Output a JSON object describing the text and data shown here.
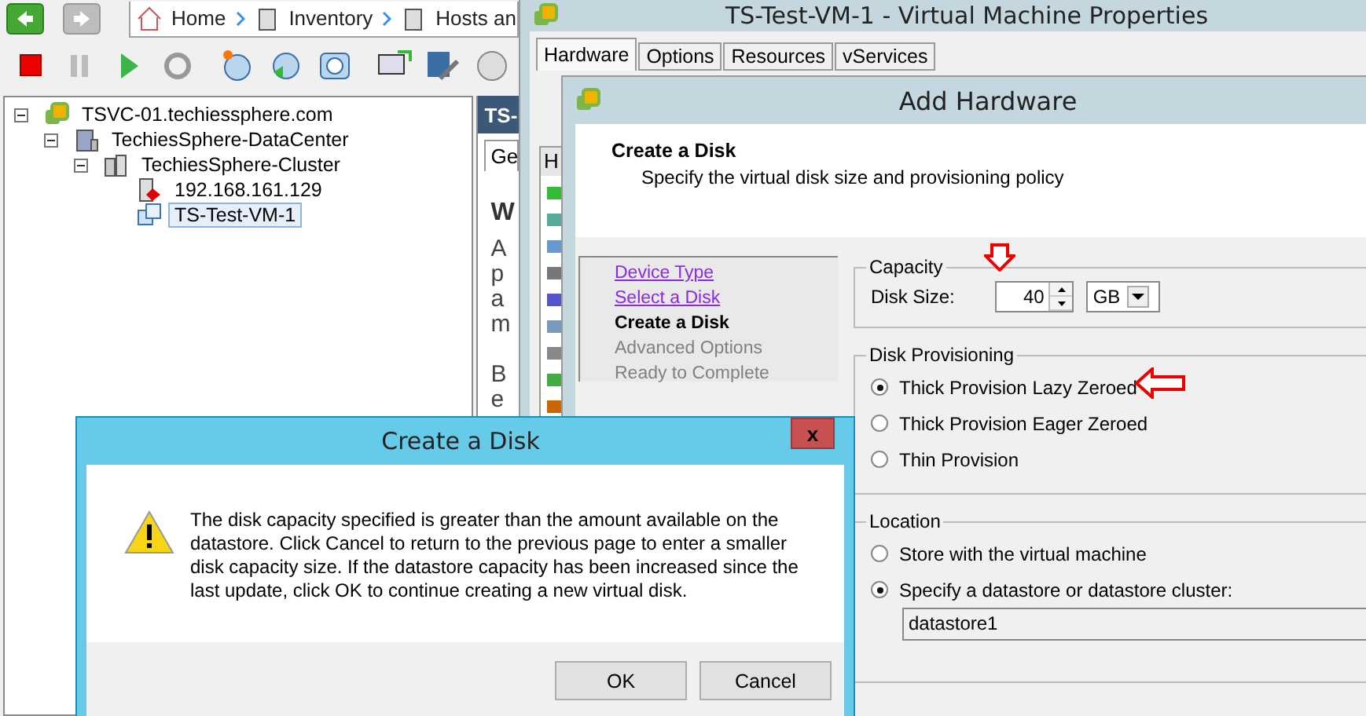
{
  "main_window": {
    "breadcrumb": [
      "Home",
      "Inventory",
      "Hosts an"
    ],
    "tree": [
      {
        "label": "TSVC-01.techiessphere.com",
        "kind": "vcenter",
        "expanded": true,
        "selected": false,
        "children": [
          {
            "label": "TechiesSphere-DataCenter",
            "kind": "datacenter",
            "expanded": true,
            "selected": false,
            "children": [
              {
                "label": "TechiesSphere-Cluster",
                "kind": "cluster",
                "expanded": true,
                "selected": false,
                "children": [
                  {
                    "label": "192.168.161.129",
                    "kind": "host",
                    "selected": false
                  },
                  {
                    "label": "TS-Test-VM-1",
                    "kind": "vm",
                    "selected": true
                  }
                ]
              }
            ]
          }
        ]
      }
    ],
    "detail_panel": {
      "title": "TS-",
      "tab": "Ge",
      "heading": "W",
      "fragments": [
        "A",
        "p",
        "a",
        "m",
        "B",
        "e"
      ]
    }
  },
  "vm_properties": {
    "title": "TS-Test-VM-1 - Virtual Machine Properties",
    "tabs": [
      {
        "label": "Hardware",
        "selected": true
      },
      {
        "label": "Options",
        "selected": false
      },
      {
        "label": "Resources",
        "selected": false
      },
      {
        "label": "vServices",
        "selected": false
      }
    ],
    "list_header": "H"
  },
  "add_hardware": {
    "title": "Add Hardware",
    "step_title": "Create a Disk",
    "step_subtitle": "Specify the virtual disk size and provisioning policy",
    "steps": [
      {
        "label": "Device Type",
        "kind": "link"
      },
      {
        "label": "Select a Disk",
        "kind": "link"
      },
      {
        "label": "Create a Disk",
        "kind": "current"
      },
      {
        "label": "Advanced Options",
        "kind": "pending"
      },
      {
        "label": "Ready to Complete",
        "kind": "pending"
      }
    ],
    "capacity": {
      "legend": "Capacity",
      "label": "Disk Size:",
      "value": "40",
      "unit": "GB"
    },
    "provisioning": {
      "legend": "Disk Provisioning",
      "options": [
        {
          "label": "Thick Provision Lazy Zeroed",
          "selected": true
        },
        {
          "label": "Thick Provision Eager Zeroed",
          "selected": false
        },
        {
          "label": "Thin Provision",
          "selected": false
        }
      ]
    },
    "location": {
      "legend": "Location",
      "options": [
        {
          "label": "Store with the virtual machine",
          "selected": false
        },
        {
          "label": "Specify a datastore or datastore cluster:",
          "selected": true
        }
      ],
      "datastore": "datastore1"
    }
  },
  "alert": {
    "title": "Create a Disk",
    "close": "x",
    "message": "The disk capacity specified is greater than the amount available on the datastore. Click Cancel to return to the previous page to enter a smaller disk capacity size. If the datastore capacity has been increased since the last update, click OK to continue creating a new virtual disk.",
    "buttons": [
      "OK",
      "Cancel"
    ]
  }
}
